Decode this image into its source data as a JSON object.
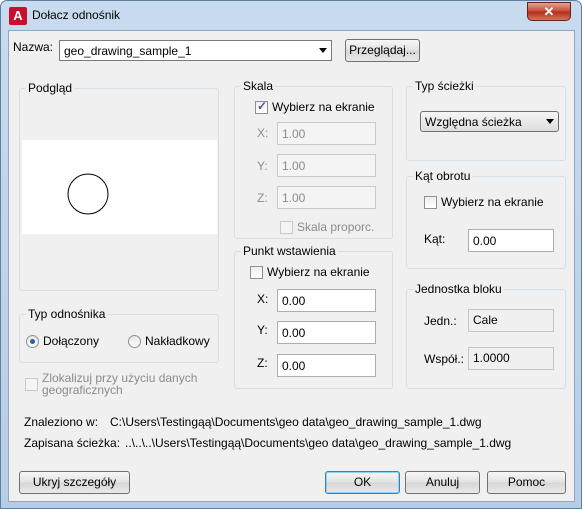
{
  "window": {
    "title": "Dołacz odnośnik",
    "app_icon_glyph": "A",
    "close_glyph": "✕"
  },
  "name_row": {
    "label": "Nazwa:",
    "value": "geo_drawing_sample_1",
    "browse_button": "Przeglądaj..."
  },
  "preview": {
    "title": "Podgląd"
  },
  "scale": {
    "title": "Skala",
    "specify_on_screen": "Wybierz na ekranie",
    "specify_checked": true,
    "x_label": "X:",
    "x_value": "1.00",
    "y_label": "Y:",
    "y_value": "1.00",
    "z_label": "Z:",
    "z_value": "1.00",
    "uniform_scale": "Skala proporc."
  },
  "path_type": {
    "title": "Typ ścieżki",
    "value": "Względna ścieżka"
  },
  "rotation": {
    "title": "Kąt obrotu",
    "specify_on_screen": "Wybierz na ekranie",
    "angle_label": "Kąt:",
    "angle_value": "0.00"
  },
  "insertion_point": {
    "title": "Punkt wstawienia",
    "specify_on_screen": "Wybierz na ekranie",
    "x_label": "X:",
    "x_value": "0.00",
    "y_label": "Y:",
    "y_value": "0.00",
    "z_label": "Z:",
    "z_value": "0.00"
  },
  "block_unit": {
    "title": "Jednostka bloku",
    "unit_label": "Jedn.:",
    "unit_value": "Cale",
    "factor_label": "Współ.:",
    "factor_value": "1.0000"
  },
  "reference_type": {
    "title": "Typ odnośnika",
    "attachment": "Dołączony",
    "overlay": "Nakładkowy",
    "selected": "attachment"
  },
  "locate_geo": {
    "line1": "Zlokalizuj przy użyciu danych",
    "line2": "geograficznych"
  },
  "paths": {
    "found_label": "Znaleziono w:",
    "found_value": "C:\\Users\\Testingąą\\Documents\\geo data\\geo_drawing_sample_1.dwg",
    "saved_label": "Zapisana ścieżka:",
    "saved_value": "..\\..\\..\\Users\\Testingąą\\Documents\\geo data\\geo_drawing_sample_1.dwg"
  },
  "buttons": {
    "hide_details": "Ukryj szczegóły",
    "ok": "OK",
    "cancel": "Anuluj",
    "help": "Pomoc"
  },
  "colors": {
    "accent": "#3c7fb1",
    "close_red": "#c34a33",
    "app_icon_red": "#c8102e"
  }
}
